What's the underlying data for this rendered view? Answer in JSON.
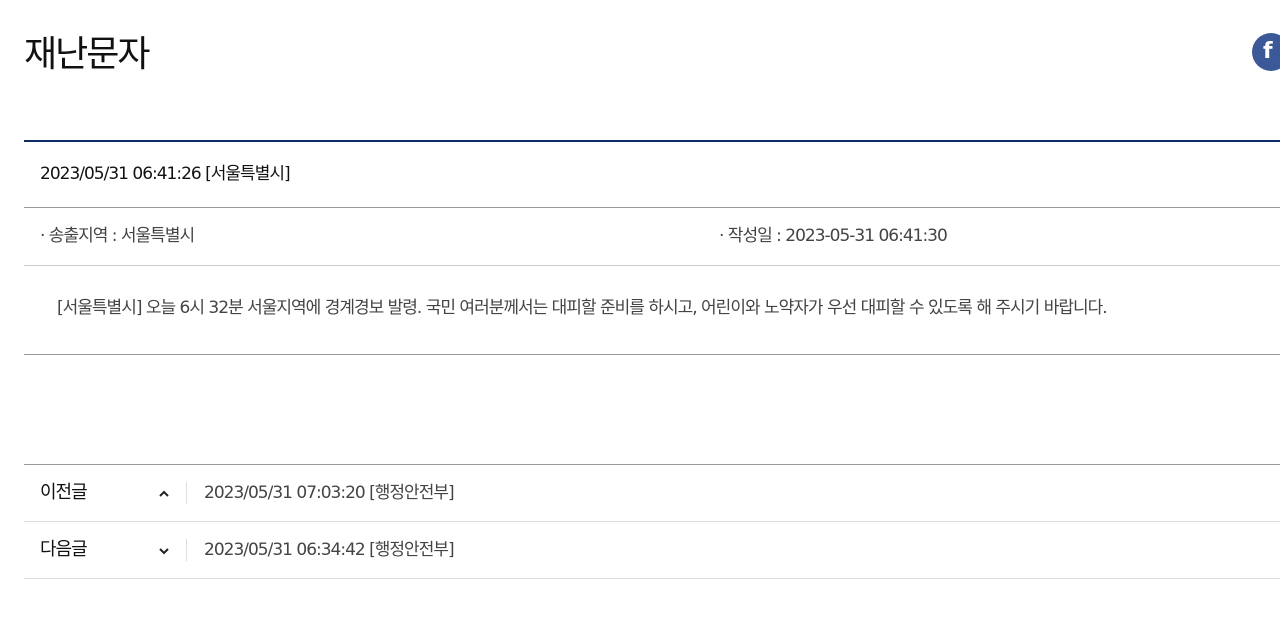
{
  "page": {
    "title": "재난문자",
    "share_facebook_label": "f"
  },
  "message": {
    "header": "2023/05/31 06:41:26 [서울특별시]",
    "region_text": "· 송출지역 : 서울특별시",
    "created_text": "· 작성일 : 2023-05-31 06:41:30",
    "body": "[서울특별시] 오늘 6시 32분 서울지역에 경계경보 발령. 국민 여러분께서는 대피할 준비를 하시고, 어린이와 노약자가 우선 대피할 수 있도록 해 주시기 바랍니다."
  },
  "navigation": {
    "previous": {
      "label": "이전글",
      "icon": "chevron-up-icon",
      "title": "2023/05/31 07:03:20 [행정안전부]"
    },
    "next": {
      "label": "다음글",
      "icon": "chevron-down-icon",
      "title": "2023/05/31 06:34:42 [행정안전부]"
    }
  },
  "colors": {
    "accent_border": "#0e2a6b",
    "facebook": "#3b5998"
  }
}
